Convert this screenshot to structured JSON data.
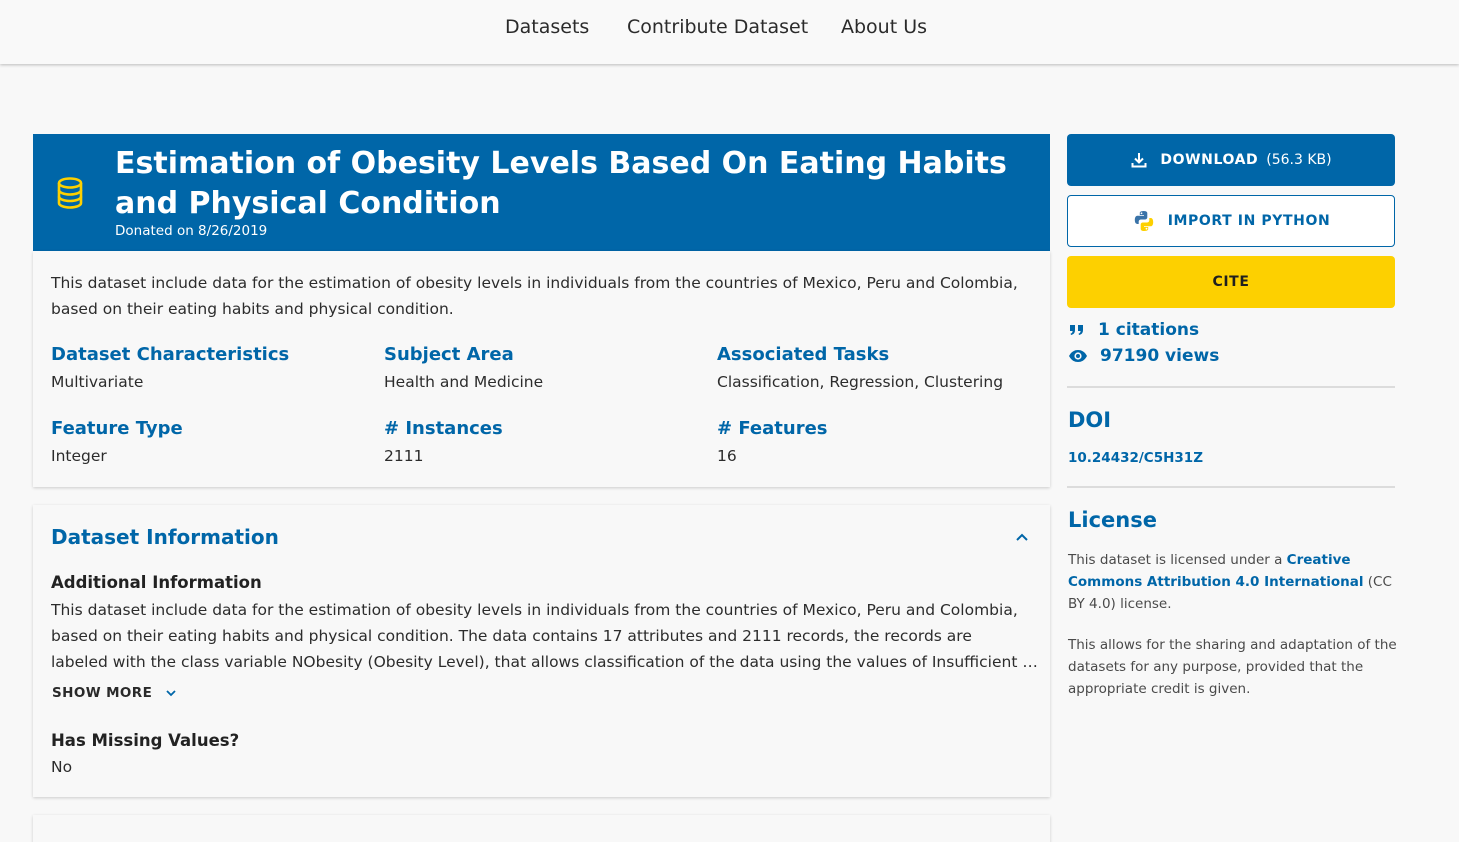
{
  "nav": {
    "datasets": "Datasets",
    "contribute": "Contribute Dataset",
    "about": "About Us"
  },
  "hero": {
    "icon": "database-icon",
    "title": "Estimation of Obesity Levels Based On Eating Habits and Physical Condition",
    "donated": "Donated on 8/26/2019"
  },
  "summary": {
    "description": "This dataset include data for the estimation of obesity levels in individuals from the countries of Mexico, Peru and Colombia, based on their eating habits and physical condition.",
    "stats": [
      {
        "label": "Dataset Characteristics",
        "value": "Multivariate"
      },
      {
        "label": "Subject Area",
        "value": "Health and Medicine"
      },
      {
        "label": "Associated Tasks",
        "value": "Classification, Regression, Clustering"
      },
      {
        "label": "Feature Type",
        "value": "Integer"
      },
      {
        "label": "# Instances",
        "value": "2111"
      },
      {
        "label": "# Features",
        "value": "16"
      }
    ]
  },
  "info": {
    "title": "Dataset Information",
    "additional_label": "Additional Information",
    "additional_l1": "This dataset include data for the estimation of obesity levels in individuals from the countries of Mexico, Peru and Colombia,",
    "additional_l2": "based on their eating habits and physical condition. The data contains 17 attributes and 2111 records, the records are",
    "additional_l3": "labeled with the class variable NObesity (Obesity Level), that allows classification of the data using the values of Insufficient Weight",
    "show_more": "SHOW MORE",
    "missing_label": "Has Missing Values?",
    "missing_value": "No"
  },
  "sidebar": {
    "download_label": "DOWNLOAD",
    "download_size": "(56.3 KB)",
    "python_label": "IMPORT IN PYTHON",
    "cite_label": "CITE",
    "citations": "1 citations",
    "views": "97190 views",
    "doi_title": "DOI",
    "doi": "10.24432/C5H31Z",
    "license_title": "License",
    "license_pre": "This dataset is licensed under a ",
    "license_link": "Creative Commons Attribution 4.0 International",
    "license_post": " (CC BY 4.0) license.",
    "license_desc": "This allows for the sharing and adaptation of the datasets for any purpose, provided that the appropriate credit is given."
  },
  "colors": {
    "brand_blue": "#0066a8",
    "cite_yellow": "#fdd000",
    "background": "#f8f8f8"
  }
}
